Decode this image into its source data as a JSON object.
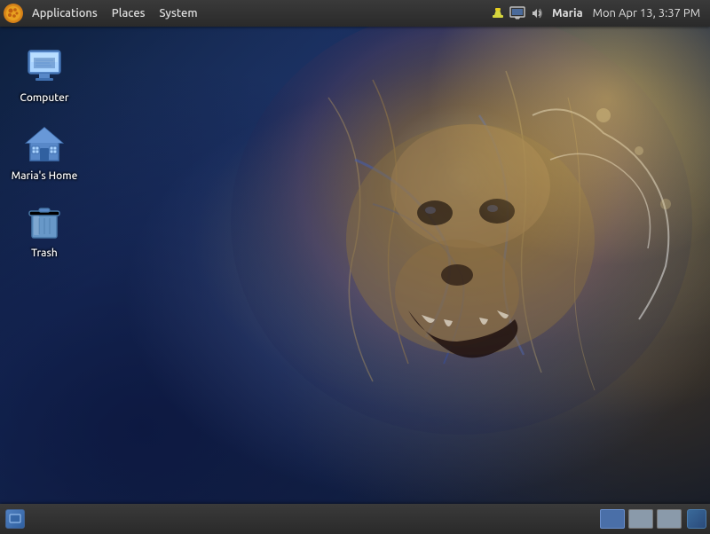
{
  "taskbar": {
    "apps_label": "Applications",
    "places_label": "Places",
    "system_label": "System",
    "username": "Maria",
    "datetime": "Mon Apr 13,  3:37 PM"
  },
  "desktop_icons": [
    {
      "id": "computer",
      "label": "Computer"
    },
    {
      "id": "marias-home",
      "label": "Maria's Home"
    },
    {
      "id": "trash",
      "label": "Trash"
    }
  ],
  "workspaces": [
    {
      "id": 1,
      "active": true
    },
    {
      "id": 2,
      "active": false
    },
    {
      "id": 3,
      "active": false
    }
  ]
}
